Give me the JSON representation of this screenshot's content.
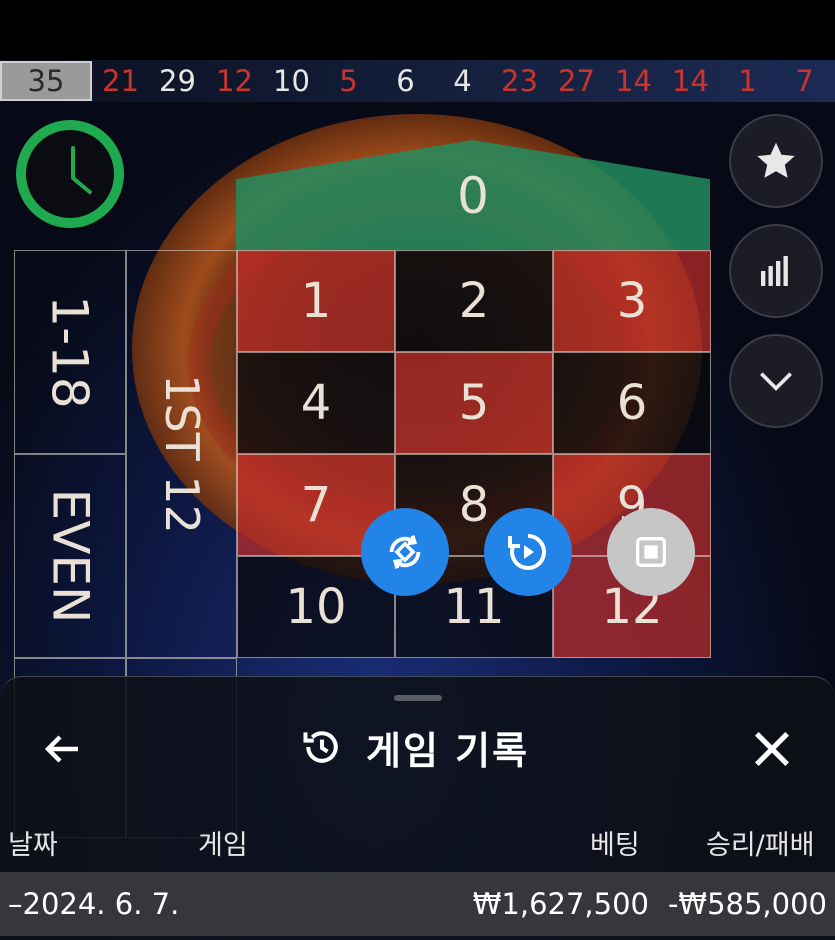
{
  "history": {
    "numbers": [
      {
        "value": "35",
        "color": "grey"
      },
      {
        "value": "21",
        "color": "red"
      },
      {
        "value": "29",
        "color": "black"
      },
      {
        "value": "12",
        "color": "red"
      },
      {
        "value": "10",
        "color": "black"
      },
      {
        "value": "5",
        "color": "red"
      },
      {
        "value": "6",
        "color": "black"
      },
      {
        "value": "4",
        "color": "black"
      },
      {
        "value": "23",
        "color": "red"
      },
      {
        "value": "27",
        "color": "red"
      },
      {
        "value": "14",
        "color": "red"
      },
      {
        "value": "14",
        "color": "red"
      },
      {
        "value": "1",
        "color": "red"
      },
      {
        "value": "7",
        "color": "red"
      }
    ]
  },
  "side_buttons": [
    "star-icon",
    "stats-icon",
    "chevron-down-icon"
  ],
  "table": {
    "zero": "0",
    "rows": [
      [
        {
          "n": "1",
          "c": "r"
        },
        {
          "n": "2",
          "c": "b"
        },
        {
          "n": "3",
          "c": "r"
        }
      ],
      [
        {
          "n": "4",
          "c": "b"
        },
        {
          "n": "5",
          "c": "r"
        },
        {
          "n": "6",
          "c": "b"
        }
      ],
      [
        {
          "n": "7",
          "c": "r"
        },
        {
          "n": "8",
          "c": "b"
        },
        {
          "n": "9",
          "c": "r"
        }
      ],
      [
        {
          "n": "10",
          "c": "b"
        },
        {
          "n": "11",
          "c": "b"
        },
        {
          "n": "12",
          "c": "r"
        }
      ]
    ],
    "outside_low": "1-18",
    "outside_even": "EVEN",
    "dozen_first": "1ST 12"
  },
  "floating_buttons": [
    "swap-icon",
    "autoplay-icon",
    "stop-icon"
  ],
  "sheet": {
    "title": "게임 기록",
    "columns": {
      "date": "날짜",
      "game": "게임",
      "bet": "베팅",
      "result": "승리/패배"
    },
    "row": {
      "date": "–2024. 6. 7.",
      "bet": "₩1,627,500",
      "result": "-₩585,000"
    }
  },
  "colors": {
    "red": "#c8352e",
    "green": "#1faa4f",
    "accent_blue": "#2384e8"
  }
}
